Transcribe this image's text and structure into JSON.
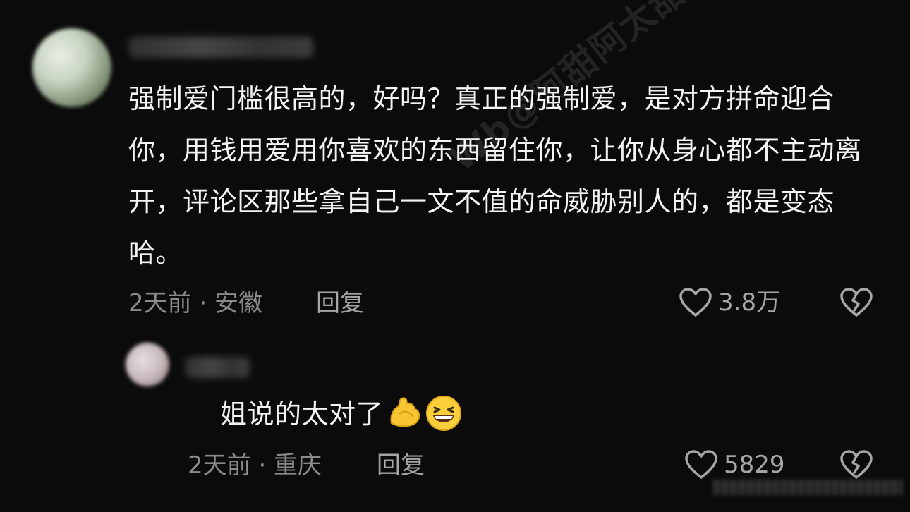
{
  "watermark": "Wb@阿甜阿太甜阿",
  "comments": [
    {
      "text": "强制爱门槛很高的，好吗？真正的强制爱，是对方拼命迎合你，用钱用爱用你喜欢的东西留住你，让你从身心都不主动离开，评论区那些拿自己一文不值的命威胁别人的，都是变态哈。",
      "meta": "2天前 · 安徽",
      "reply_label": "回复",
      "likes": "3.8万"
    }
  ],
  "replies": [
    {
      "text": "姐说的太对了",
      "emojis": [
        "flexed-biceps-icon",
        "grinning-squinting-face-icon"
      ],
      "meta": "2天前 · 重庆",
      "reply_label": "回复",
      "likes": "5829"
    }
  ]
}
